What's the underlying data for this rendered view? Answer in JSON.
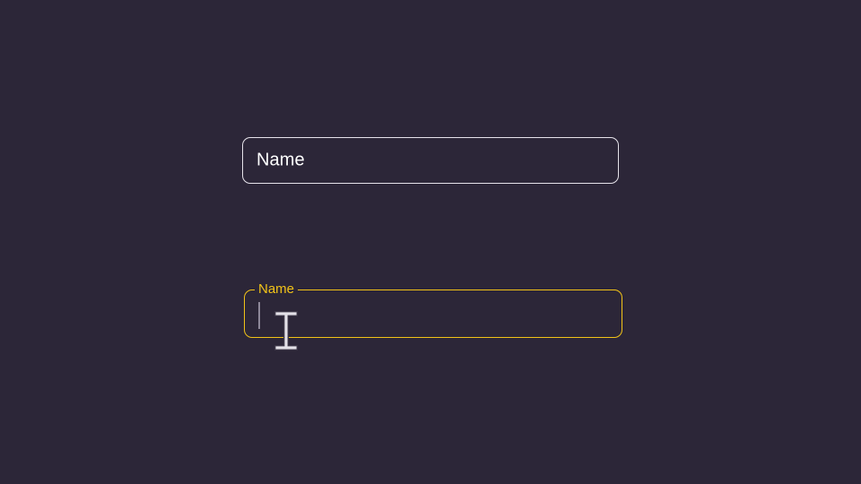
{
  "fields": {
    "idle": {
      "label": "Name"
    },
    "focused": {
      "label": "Name",
      "value": ""
    }
  },
  "colors": {
    "background": "#2c2638",
    "idle_border": "#e6e3ea",
    "focus_accent": "#f2c318",
    "caret": "#8d8799"
  },
  "cursor": {
    "icon": "text-ibeam-cursor-icon"
  }
}
